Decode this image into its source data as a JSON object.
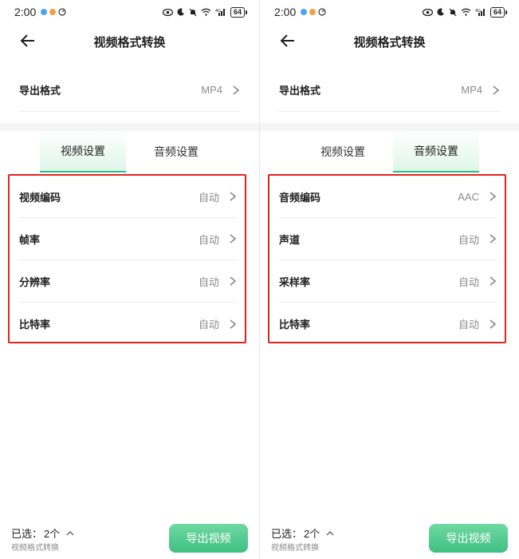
{
  "colors": {
    "accent_green": "#3fc083",
    "highlight_red": "#e0241b",
    "secondary_text": "#8a8a8a"
  },
  "panels": [
    {
      "status": {
        "time": "2:00",
        "battery": "64"
      },
      "header": {
        "title": "视频格式转换",
        "back_icon": "arrow-left-icon"
      },
      "export_format": {
        "label": "导出格式",
        "value": "MP4"
      },
      "tabs": [
        {
          "label": "视频设置",
          "active": true
        },
        {
          "label": "音频设置",
          "active": false
        }
      ],
      "settings": [
        {
          "label": "视频编码",
          "value": "自动"
        },
        {
          "label": "帧率",
          "value": "自动"
        },
        {
          "label": "分辨率",
          "value": "自动"
        },
        {
          "label": "比特率",
          "value": "自动"
        }
      ],
      "bottom": {
        "selected_label": "已选：",
        "selected_count": "2个",
        "subtitle": "视频格式转换",
        "export_button": "导出视频"
      }
    },
    {
      "status": {
        "time": "2:00",
        "battery": "64"
      },
      "header": {
        "title": "视频格式转换",
        "back_icon": "arrow-left-icon"
      },
      "export_format": {
        "label": "导出格式",
        "value": "MP4"
      },
      "tabs": [
        {
          "label": "视频设置",
          "active": false
        },
        {
          "label": "音频设置",
          "active": true
        }
      ],
      "settings": [
        {
          "label": "音频编码",
          "value": "AAC"
        },
        {
          "label": "声道",
          "value": "自动"
        },
        {
          "label": "采样率",
          "value": "自动"
        },
        {
          "label": "比特率",
          "value": "自动"
        }
      ],
      "bottom": {
        "selected_label": "已选：",
        "selected_count": "2个",
        "subtitle": "视频格式转换",
        "export_button": "导出视频"
      }
    }
  ]
}
